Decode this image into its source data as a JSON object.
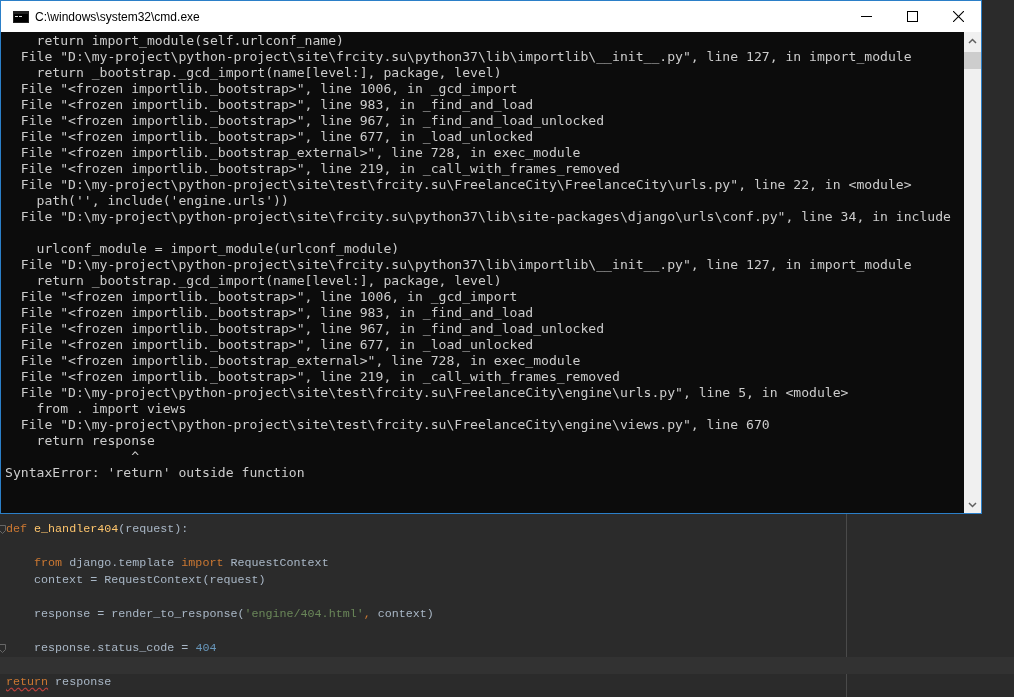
{
  "console": {
    "title": "C:\\windows\\system32\\cmd.exe",
    "lines": [
      {
        "text": "    return import_module(self.urlconf_name)"
      },
      {
        "text": "  File \"D:\\my-project\\python-project\\site\\frcity.su\\python37\\lib\\importlib\\__init__.py\", line 127, in import_module"
      },
      {
        "text": "    return _bootstrap._gcd_import(name[level:], package, level)"
      },
      {
        "text": "  File \"<frozen importlib._bootstrap>\", line 1006, in _gcd_import"
      },
      {
        "text": "  File \"<frozen importlib._bootstrap>\", line 983, in _find_and_load"
      },
      {
        "text": "  File \"<frozen importlib._bootstrap>\", line 967, in _find_and_load_unlocked"
      },
      {
        "text": "  File \"<frozen importlib._bootstrap>\", line 677, in _load_unlocked"
      },
      {
        "text": "  File \"<frozen importlib._bootstrap_external>\", line 728, in exec_module"
      },
      {
        "text": "  File \"<frozen importlib._bootstrap>\", line 219, in _call_with_frames_removed"
      },
      {
        "text": "  File \"D:\\my-project\\python-project\\site\\test\\frcity.su\\FreelanceCity\\FreelanceCity\\urls.py\", line 22, in <module>"
      },
      {
        "text": "    path('', include('engine.urls'))"
      },
      {
        "text": "  File \"D:\\my-project\\python-project\\site\\frcity.su\\python37\\lib\\site-packages\\django\\urls\\conf.py\", line 34, in include"
      },
      {
        "kind": "blank"
      },
      {
        "text": "    urlconf_module = import_module(urlconf_module)"
      },
      {
        "text": "  File \"D:\\my-project\\python-project\\site\\frcity.su\\python37\\lib\\importlib\\__init__.py\", line 127, in import_module"
      },
      {
        "text": "    return _bootstrap._gcd_import(name[level:], package, level)"
      },
      {
        "text": "  File \"<frozen importlib._bootstrap>\", line 1006, in _gcd_import"
      },
      {
        "text": "  File \"<frozen importlib._bootstrap>\", line 983, in _find_and_load"
      },
      {
        "text": "  File \"<frozen importlib._bootstrap>\", line 967, in _find_and_load_unlocked"
      },
      {
        "text": "  File \"<frozen importlib._bootstrap>\", line 677, in _load_unlocked"
      },
      {
        "text": "  File \"<frozen importlib._bootstrap_external>\", line 728, in exec_module"
      },
      {
        "text": "  File \"<frozen importlib._bootstrap>\", line 219, in _call_with_frames_removed"
      },
      {
        "text": "  File \"D:\\my-project\\python-project\\site\\test\\frcity.su\\FreelanceCity\\engine\\urls.py\", line 5, in <module>"
      },
      {
        "text": "    from . import views"
      },
      {
        "text": "  File \"D:\\my-project\\python-project\\site\\test\\frcity.su\\FreelanceCity\\engine\\views.py\", line 670"
      },
      {
        "text": "    return response"
      },
      {
        "text": "                ^"
      },
      {
        "text": "SyntaxError: 'return' outside function"
      }
    ]
  },
  "editor": {
    "lines": [
      {
        "fold": true,
        "tokens": [
          {
            "kind": "keyword",
            "text": "def "
          },
          {
            "kind": "function",
            "text": "e_handler404"
          },
          {
            "kind": "plain",
            "text": "(request):"
          }
        ]
      },
      {
        "kind": "blank"
      },
      {
        "fold": false,
        "tokens": [
          {
            "kind": "keyword",
            "text": "    from "
          },
          {
            "kind": "plain",
            "text": "django.template "
          },
          {
            "kind": "keyword",
            "text": "import "
          },
          {
            "kind": "plain",
            "text": "RequestContext"
          }
        ]
      },
      {
        "fold": false,
        "tokens": [
          {
            "kind": "plain",
            "text": "    context = RequestContext(request)"
          }
        ]
      },
      {
        "kind": "blank"
      },
      {
        "fold": false,
        "tokens": [
          {
            "kind": "plain",
            "text": "    response = render_to_response("
          },
          {
            "kind": "string",
            "text": "'engine/404.html'"
          },
          {
            "kind": "keyword",
            "text": ", "
          },
          {
            "kind": "plain",
            "text": "context)"
          }
        ]
      },
      {
        "kind": "blank"
      },
      {
        "fold": true,
        "tokens": [
          {
            "kind": "plain",
            "text": "    response.status_code = "
          },
          {
            "kind": "number",
            "text": "404"
          }
        ]
      },
      {
        "kind": "highlighted"
      },
      {
        "fold": false,
        "tokens": [
          {
            "kind": "keyword",
            "text": "return",
            "error": true
          },
          {
            "kind": "plain",
            "text": " response"
          }
        ]
      }
    ]
  }
}
